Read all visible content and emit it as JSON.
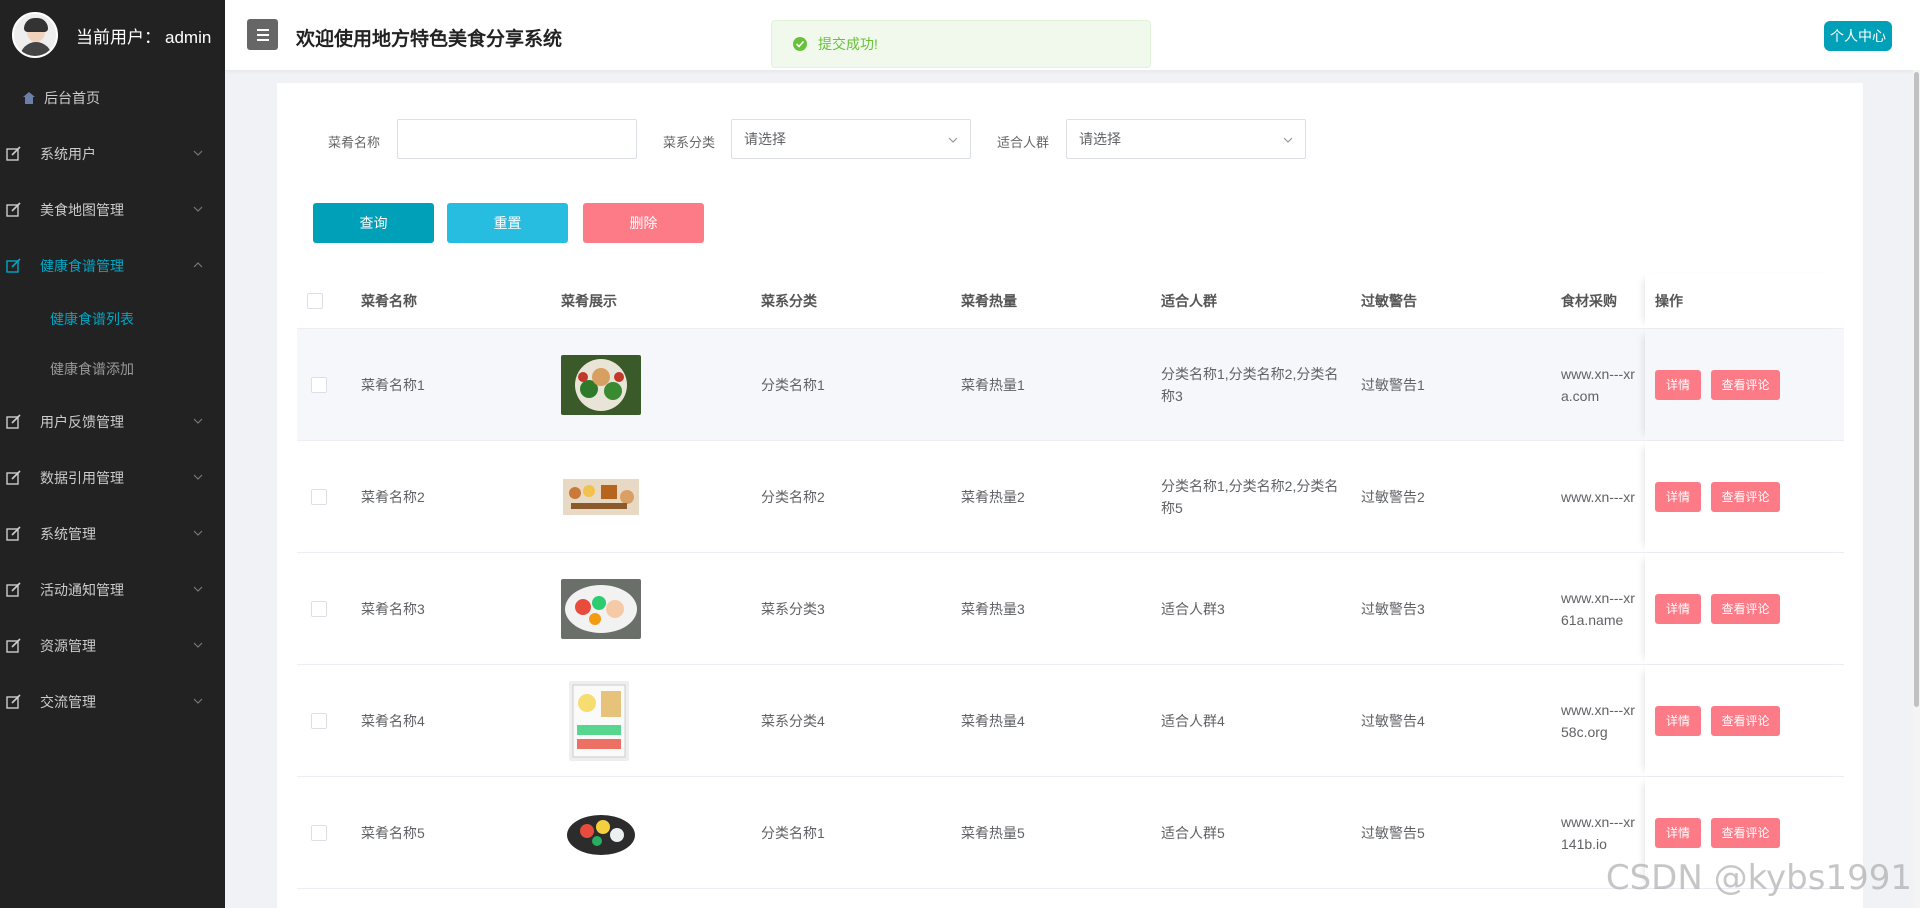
{
  "header": {
    "current_user_label": "当前用户：",
    "username": "admin",
    "title": "欢迎使用地方特色美食分享系统",
    "toast": "提交成功!",
    "personal_center": "个人中心"
  },
  "sidebar": {
    "home": "后台首页",
    "items": [
      {
        "label": "系统用户"
      },
      {
        "label": "美食地图管理"
      },
      {
        "label": "健康食谱管理",
        "sub": [
          "健康食谱列表",
          "健康食谱添加"
        ]
      },
      {
        "label": "用户反馈管理"
      },
      {
        "label": "数据引用管理"
      },
      {
        "label": "系统管理"
      },
      {
        "label": "活动通知管理"
      },
      {
        "label": "资源管理"
      },
      {
        "label": "交流管理"
      }
    ]
  },
  "search": {
    "name_label": "菜肴名称",
    "name_value": "",
    "category_label": "菜系分类",
    "category_placeholder": "请选择",
    "crowd_label": "适合人群",
    "crowd_placeholder": "请选择"
  },
  "buttons": {
    "query": "查询",
    "reset": "重置",
    "delete": "删除"
  },
  "table": {
    "columns": [
      "菜肴名称",
      "菜肴展示",
      "菜系分类",
      "菜肴热量",
      "适合人群",
      "过敏警告",
      "食材采购",
      "操作"
    ],
    "detail_label": "详情",
    "comment_label": "查看评论",
    "rows": [
      {
        "name": "菜肴名称1",
        "category": "分类名称1",
        "calories": "菜肴热量1",
        "crowd_line1": "分类名称1,分类名称2,分类名",
        "crowd_line2": "称3",
        "allergy": "过敏警告1",
        "purchase_line1": "www.xn---xr",
        "purchase_line2": "a.com"
      },
      {
        "name": "菜肴名称2",
        "category": "分类名称2",
        "calories": "菜肴热量2",
        "crowd_line1": "分类名称1,分类名称2,分类名",
        "crowd_line2": "称5",
        "allergy": "过敏警告2",
        "purchase_line1": "www.xn---xr",
        "purchase_line2": ""
      },
      {
        "name": "菜肴名称3",
        "category": "菜系分类3",
        "calories": "菜肴热量3",
        "crowd_line1": "适合人群3",
        "crowd_line2": "",
        "allergy": "过敏警告3",
        "purchase_line1": "www.xn---xr",
        "purchase_line2": "61a.name"
      },
      {
        "name": "菜肴名称4",
        "category": "菜系分类4",
        "calories": "菜肴热量4",
        "crowd_line1": "适合人群4",
        "crowd_line2": "",
        "allergy": "过敏警告4",
        "purchase_line1": "www.xn---xr",
        "purchase_line2": "58c.org"
      },
      {
        "name": "菜肴名称5",
        "category": "分类名称1",
        "calories": "菜肴热量5",
        "crowd_line1": "适合人群5",
        "crowd_line2": "",
        "allergy": "过敏警告5",
        "purchase_line1": "www.xn---xr",
        "purchase_line2": "141b.io"
      }
    ]
  },
  "watermark": "CSDN @kybs1991",
  "colors": {
    "accent": "#00a0b8",
    "danger": "#fd7b87",
    "reset": "#26bde0",
    "sidebar": "#222222",
    "success": "#67c23a"
  }
}
